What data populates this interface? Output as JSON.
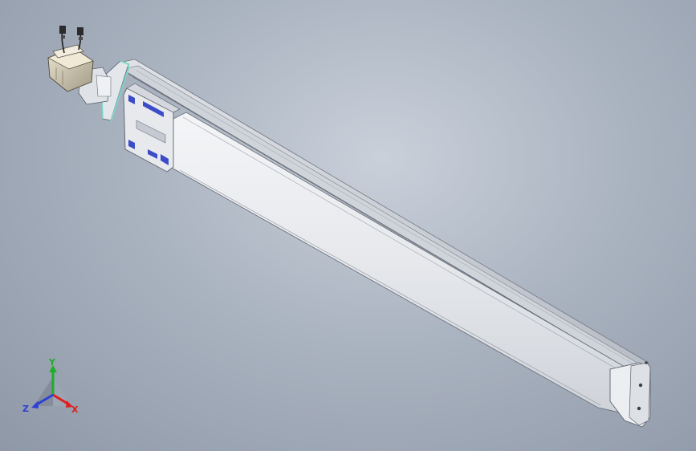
{
  "view": {
    "background": [
      "#c9d0da",
      "#aab3c0",
      "#8f98a7"
    ]
  },
  "model": {
    "body_color": "#e9ebee",
    "rail_color": "#c8ccd3",
    "accent_blue": "#3b4cc7",
    "accent_teal": "#7fd3c4",
    "wire_color": "#1d1d1d"
  },
  "triad": {
    "x_label": "X",
    "y_label": "Y",
    "z_label": "Z",
    "x_color": "#e01e1e",
    "y_color": "#1fae2a",
    "z_color": "#2c3fd6"
  }
}
